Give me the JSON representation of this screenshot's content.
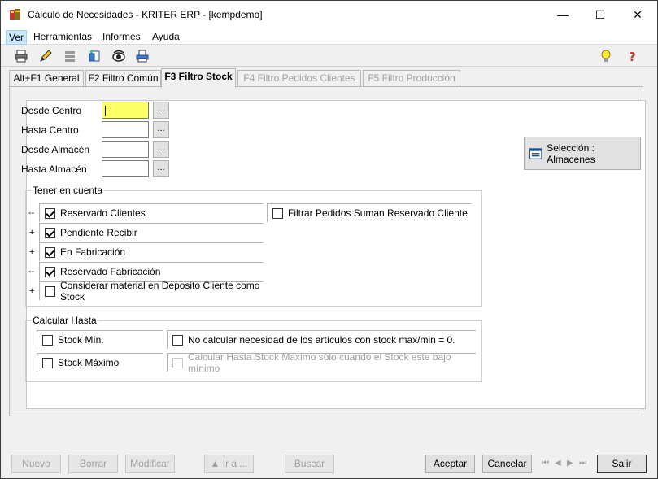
{
  "window": {
    "title": "Cálculo de Necesidades - KRITER ERP - [kempdemo]",
    "minimize_glyph": "—",
    "maximize_glyph": "☐",
    "close_glyph": "✕"
  },
  "menu": {
    "items": [
      {
        "label": "Ver"
      },
      {
        "label": "Herramientas"
      },
      {
        "label": "Informes"
      },
      {
        "label": "Ayuda"
      }
    ]
  },
  "toolbar": {
    "icons": [
      "print-icon",
      "pencil-icon",
      "list-icon",
      "document-add-icon",
      "view-eye-icon",
      "printer-preview-icon",
      "lightbulb-icon",
      "help-icon"
    ]
  },
  "tabs": [
    {
      "label": "Alt+F1 General"
    },
    {
      "label": "F2 Filtro Común"
    },
    {
      "label": "F3 Filtro Stock"
    },
    {
      "label": "F4 Filtro Pedidos Clientes"
    },
    {
      "label": "F5 Filtro Producción"
    }
  ],
  "fields": {
    "desde_centro": {
      "label": "Desde Centro",
      "value": ""
    },
    "hasta_centro": {
      "label": "Hasta Centro",
      "value": ""
    },
    "desde_almacen": {
      "label": "Desde Almacén",
      "value": ""
    },
    "hasta_almacen": {
      "label": "Hasta Almacén",
      "value": ""
    },
    "ellipsis": "..."
  },
  "seleccion_button": {
    "label": "Selección : Almacenes"
  },
  "tener_en_cuenta": {
    "title": "Tener en cuenta",
    "rows": [
      {
        "prefix": "--",
        "label": "Reservado Clientes",
        "checked": true
      },
      {
        "prefix": "+",
        "label": "Pendiente Recibir",
        "checked": true
      },
      {
        "prefix": "+",
        "label": "En Fabricación",
        "checked": true
      },
      {
        "prefix": "--",
        "label": "Reservado Fabricación",
        "checked": true
      },
      {
        "prefix": "+",
        "label": "Considerar material en Deposito Cliente como Stock",
        "checked": false
      }
    ],
    "filtrar": {
      "label": "Filtrar Pedidos Suman Reservado Cliente",
      "checked": false
    }
  },
  "calcular_hasta": {
    "title": "Calcular Hasta",
    "stock_min": {
      "label": "Stock Mín.",
      "checked": false
    },
    "stock_max": {
      "label": "Stock Máximo",
      "checked": false
    },
    "no_calcular": {
      "label": "No calcular necesidad de los artículos con stock max/min = 0.",
      "checked": false
    },
    "calcular_bajo_minimo": {
      "label": "Calcular Hasta Stock Maximo sólo cuando el Stock este bajo mínimo",
      "checked": false
    }
  },
  "buttons": {
    "nuevo": "Nuevo",
    "borrar": "Borrar",
    "modificar": "Modificar",
    "ir_a": "▲ Ir a ...",
    "buscar": "Buscar",
    "aceptar": "Aceptar",
    "cancelar": "Cancelar",
    "salir": "Salir"
  },
  "nav": {
    "first": "⏮",
    "prev": "◀",
    "next": "▶",
    "last": "⏭"
  }
}
